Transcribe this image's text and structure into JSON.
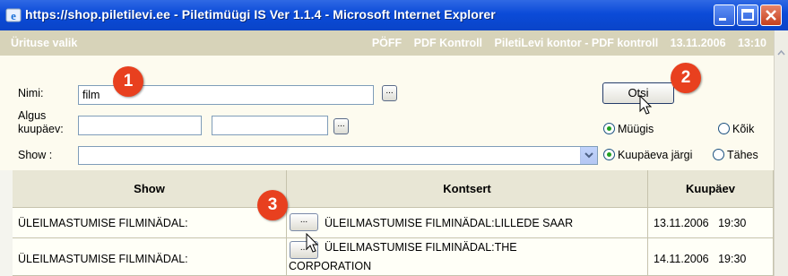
{
  "window": {
    "title": "https://shop.piletilevi.ee - Piletimüügi IS Ver 1.1.4 - Microsoft Internet Explorer"
  },
  "header": {
    "left": "Ürituse valik",
    "right_items": [
      "PÖFF",
      "PDF Kontroll",
      "PiletiLevi kontor - PDF kontroll",
      "13.11.2006",
      "13:10"
    ]
  },
  "form": {
    "nimi_label": "Nimi:",
    "nimi_value": "film",
    "algus_label_line1": "Algus",
    "algus_label_line2": "kuupäev:",
    "show_label": "Show :",
    "dots": "...",
    "search_button": "Otsi",
    "radio_myygis": "Müügis",
    "radio_koik": "Kõik",
    "radio_kuupaeva": "Kuupäeva järgi",
    "radio_tahes": "Tähes"
  },
  "table": {
    "headers": [
      "Show",
      "Kontsert",
      "Kuupäev"
    ],
    "rows": [
      {
        "show": "ÜLEILMASTUMISE FILMINÄDAL:",
        "concert_line1": "ÜLEILMASTUMISE FILMINÄDAL:LILLEDE SAAR",
        "concert_line2": "",
        "date": "13.11.2006",
        "time": "19:30"
      },
      {
        "show": "ÜLEILMASTUMISE FILMINÄDAL:",
        "concert_line1": "ÜLEILMASTUMISE FILMINÄDAL:THE",
        "concert_line2": "CORPORATION",
        "date": "14.11.2006",
        "time": "19:30"
      }
    ]
  },
  "badges": [
    "1",
    "2",
    "3"
  ],
  "colors": {
    "titlebar": "#0b4bd8",
    "header": "#d7d3b9",
    "badge": "#e8401f",
    "radio_on": "#21a121"
  }
}
